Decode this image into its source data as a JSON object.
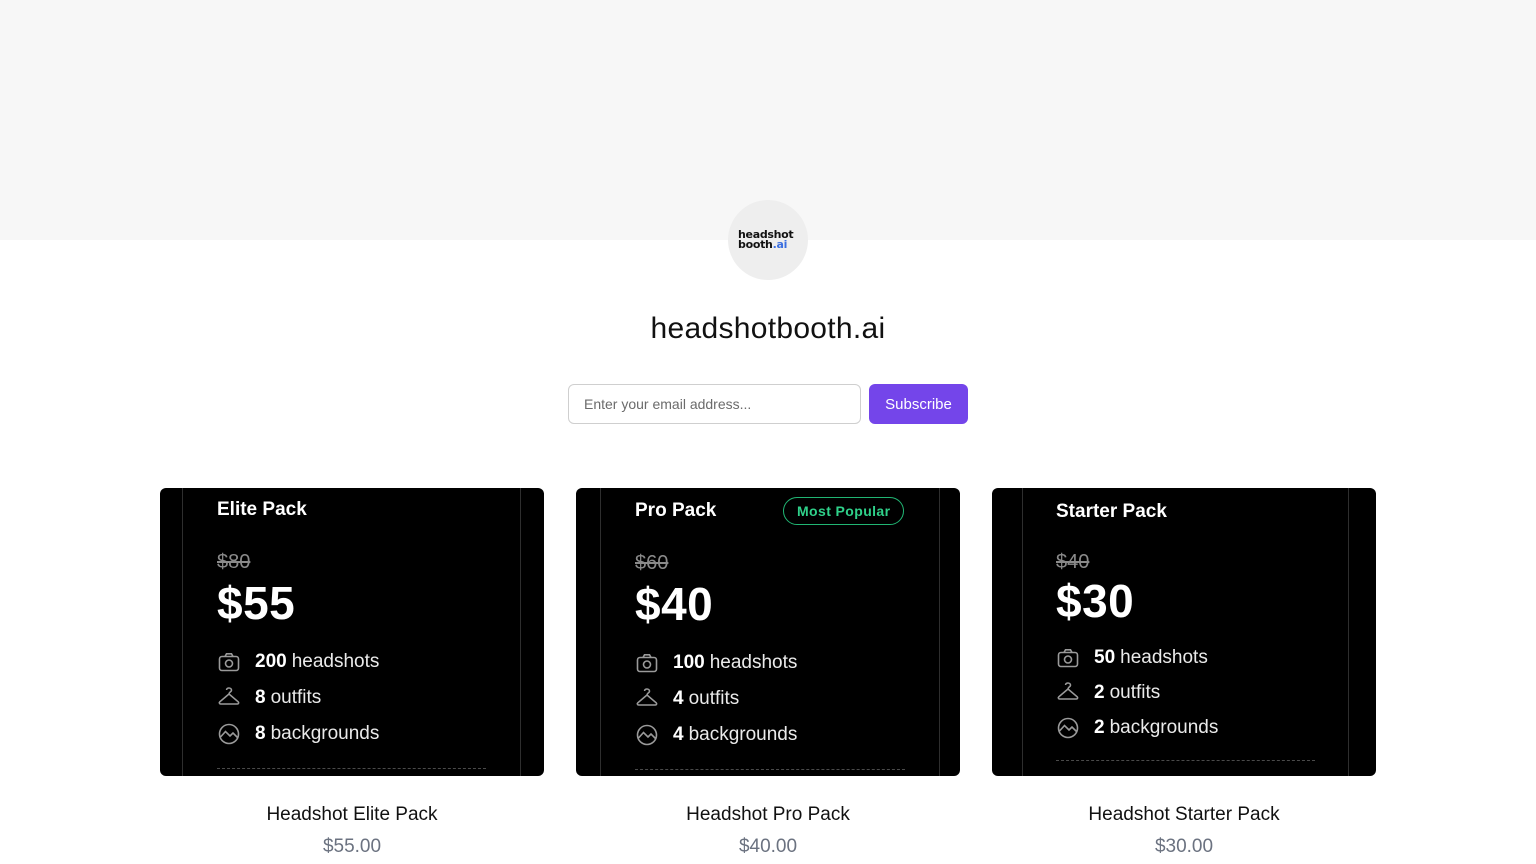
{
  "brand": {
    "logo_line1": "headshot",
    "logo_line2_main": "booth",
    "logo_line2_accent": ".ai",
    "accent_color": "#3b6fe0"
  },
  "store": {
    "title": "headshotbooth.ai"
  },
  "subscribe": {
    "placeholder": "Enter your email address...",
    "button_label": "Subscribe",
    "button_color": "#7445ea"
  },
  "products": [
    {
      "pack_name": "Elite Pack",
      "badge": "",
      "old_price": "$80",
      "new_price": "$55",
      "features": [
        {
          "icon": "camera-icon",
          "num": "200",
          "text": "headshots"
        },
        {
          "icon": "hanger-icon",
          "num": "8",
          "text": "outfits"
        },
        {
          "icon": "background-icon",
          "num": "8",
          "text": "backgrounds"
        }
      ],
      "title": "Headshot Elite Pack",
      "price": "$55.00"
    },
    {
      "pack_name": "Pro Pack",
      "badge": "Most Popular",
      "old_price": "$60",
      "new_price": "$40",
      "features": [
        {
          "icon": "camera-icon",
          "num": "100",
          "text": "headshots"
        },
        {
          "icon": "hanger-icon",
          "num": "4",
          "text": "outfits"
        },
        {
          "icon": "background-icon",
          "num": "4",
          "text": "backgrounds"
        }
      ],
      "title": "Headshot Pro Pack",
      "price": "$40.00"
    },
    {
      "pack_name": "Starter Pack",
      "badge": "",
      "old_price": "$40",
      "new_price": "$30",
      "features": [
        {
          "icon": "camera-icon",
          "num": "50",
          "text": "headshots"
        },
        {
          "icon": "hanger-icon",
          "num": "2",
          "text": "outfits"
        },
        {
          "icon": "background-icon",
          "num": "2",
          "text": "backgrounds"
        }
      ],
      "title": "Headshot Starter Pack",
      "price": "$30.00"
    }
  ]
}
